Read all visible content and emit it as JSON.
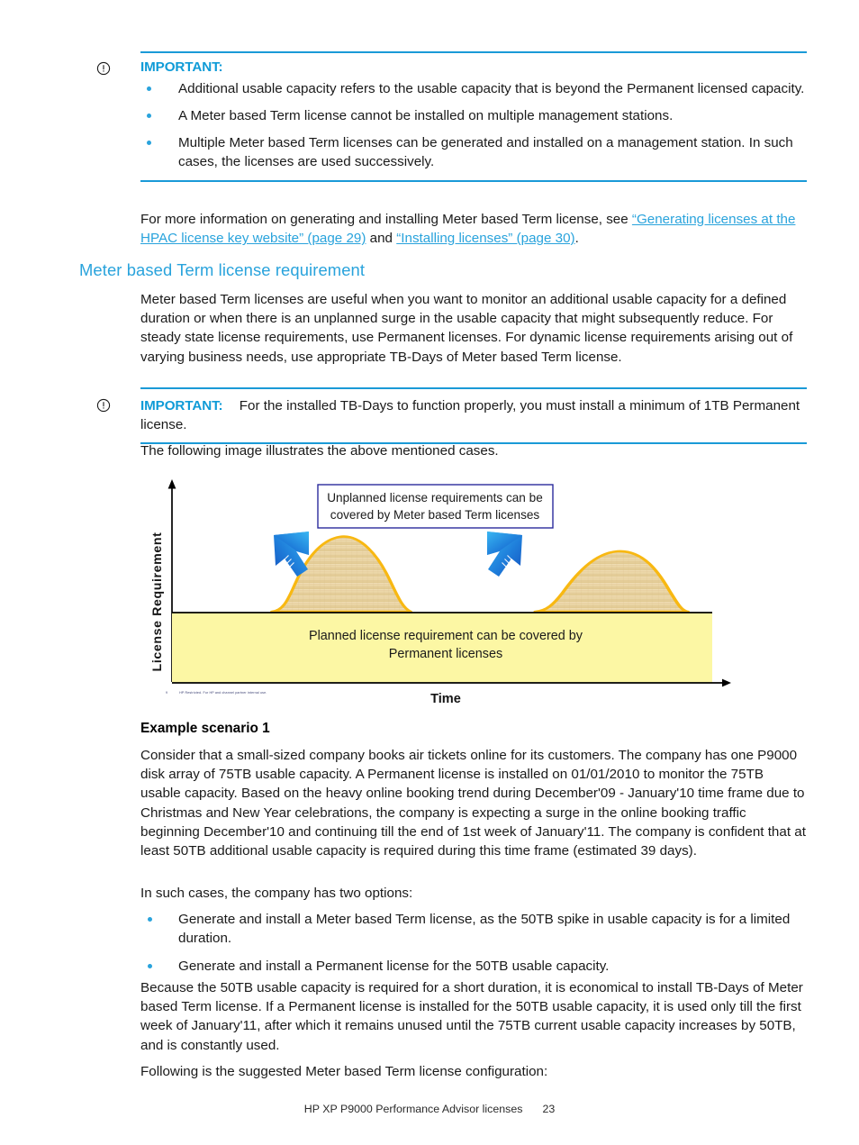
{
  "document": {
    "footer_title": "HP XP P9000 Performance Advisor licenses",
    "page_number": "23"
  },
  "important_1": {
    "icon": "important-exclamation-circle-icon",
    "title": "IMPORTANT:",
    "bullets": [
      "Additional usable capacity refers to the usable capacity that is beyond the Permanent licensed capacity.",
      "A Meter based Term license cannot be installed on multiple management stations.",
      "Multiple Meter based Term licenses can be generated and installed on a management station. In such cases, the licenses are used successively."
    ]
  },
  "cross_reference": {
    "lead": "For more information on generating and installing Meter based Term license, see ",
    "link_1": "“Generating licenses at the HPAC license key website” (page 29)",
    "conjunction": " and ",
    "link_2": "“Installing licenses” (page 30)",
    "trailer": "."
  },
  "section": {
    "heading": "Meter based Term license requirement",
    "paragraph": "Meter based Term licenses are useful when you want to monitor an additional usable capacity for a defined duration or when there is an unplanned surge in the usable capacity that might subsequently reduce. For steady state license requirements, use Permanent licenses. For dynamic license requirements arising out of varying business needs, use appropriate TB-Days of Meter based Term license."
  },
  "important_2": {
    "icon": "important-exclamation-circle-icon",
    "title": "IMPORTANT:",
    "text": "For the installed TB-Days to function properly, you must install a minimum of 1TB Permanent license."
  },
  "figure_intro": "The following image illustrates the above mentioned cases.",
  "figure": {
    "y_axis_label": "License Requirement",
    "x_axis_label": "Time",
    "callout_line_1": "Unplanned license requirements can be",
    "callout_line_2": "covered by Meter based Term licenses",
    "band_line_1": "Planned license requirement can be covered by",
    "band_line_2": "Permanent licenses",
    "slide_number": "9",
    "slide_footer": "HP Restricted. For HP and channel partner internal use.",
    "colors": {
      "band_fill": "#fbf8a8",
      "hump_fill": "#e8d2a0",
      "hump_stroke": "#f5b511",
      "callout_border": "#2a2a9c",
      "arrow_light": "#2aa8ea",
      "arrow_dark": "#1f63c9"
    }
  },
  "example": {
    "heading": "Example scenario 1",
    "paragraph_1": "Consider that a small-sized company books air tickets online for its customers. The company has one P9000 disk array of 75TB usable capacity. A Permanent license is installed on 01/01/2010 to monitor the 75TB usable capacity. Based on the heavy online booking trend during December'09 - January'10 time frame due to Christmas and New Year celebrations, the company is expecting a surge in the online booking traffic beginning December'10 and continuing till the end of 1st week of January'11. The company is confident that at least 50TB additional usable capacity is required during this time frame (estimated 39 days).",
    "options_lead": "In such cases, the company has two options:",
    "options": [
      "Generate and install a Meter based Term license, as the 50TB spike in usable capacity is for a limited duration.",
      "Generate and install a Permanent license for the 50TB usable capacity."
    ],
    "paragraph_2": "Because the 50TB usable capacity is required for a short duration, it is economical to install TB-Days of Meter based Term license. If a Permanent license is installed for the 50TB usable capacity, it is used only till the first week of January'11, after which it remains unused until the 75TB current usable capacity increases by 50TB, and is constantly used.",
    "paragraph_3": "Following is the suggested Meter based Term license configuration:"
  }
}
